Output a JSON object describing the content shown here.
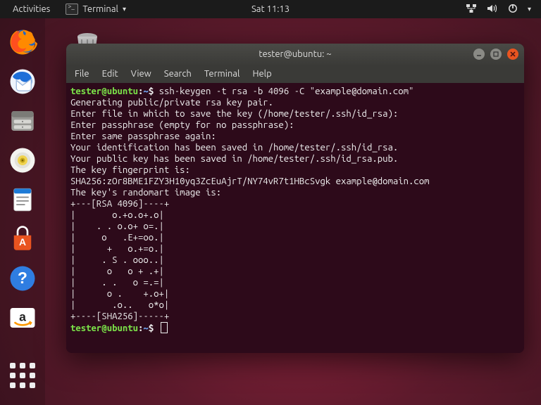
{
  "topbar": {
    "activities": "Activities",
    "app_label": "Terminal",
    "clock": "Sat 11:13"
  },
  "dock": {
    "items": [
      {
        "name": "firefox"
      },
      {
        "name": "thunderbird"
      },
      {
        "name": "files"
      },
      {
        "name": "rhythmbox"
      },
      {
        "name": "writer"
      },
      {
        "name": "software"
      },
      {
        "name": "help"
      },
      {
        "name": "amazon"
      }
    ]
  },
  "terminal": {
    "title": "tester@ubuntu: ~",
    "menus": [
      "File",
      "Edit",
      "View",
      "Search",
      "Terminal",
      "Help"
    ],
    "prompt_user": "tester@ubuntu",
    "prompt_sep": ":",
    "prompt_path": "~",
    "prompt_end": "$ ",
    "command": "ssh-keygen -t rsa -b 4096 -C \"example@domain.com\"",
    "lines": [
      "Generating public/private rsa key pair.",
      "Enter file in which to save the key (/home/tester/.ssh/id_rsa):",
      "Enter passphrase (empty for no passphrase):",
      "Enter same passphrase again:",
      "Your identification has been saved in /home/tester/.ssh/id_rsa.",
      "Your public key has been saved in /home/tester/.ssh/id_rsa.pub.",
      "The key fingerprint is:",
      "SHA256:zOr8BME1FZY3H10yq3ZcEuAjrT/NY74vR7t1HBcSvgk example@domain.com",
      "The key's randomart image is:",
      "+---[RSA 4096]----+",
      "|       o.+o.o+.o|",
      "|    . . o.o+ o=.|",
      "|     o   .E+=oo.|",
      "|      +   o.+=o.|",
      "|     . S . ooo..|",
      "|      o   o + .+|",
      "|     . .   o =.=|",
      "|      o .    +.o+|",
      "|       .o..   o*o|",
      "+----[SHA256]-----+"
    ]
  }
}
